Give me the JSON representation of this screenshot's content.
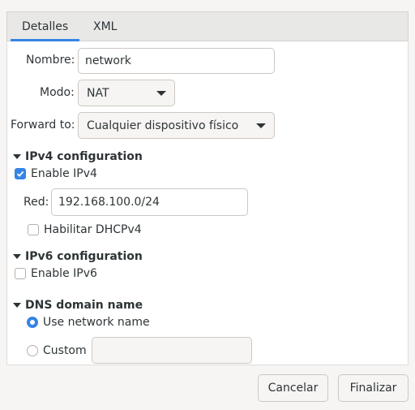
{
  "tabs": [
    {
      "label": "Detalles",
      "active": true
    },
    {
      "label": "XML",
      "active": false
    }
  ],
  "form": {
    "name_label": "Nombre:",
    "name_value": "network",
    "mode_label": "Modo:",
    "mode_value": "NAT",
    "forward_label": "Forward to:",
    "forward_value": "Cualquier dispositivo físico"
  },
  "ipv4": {
    "heading": "IPv4 configuration",
    "enable_label": "Enable IPv4",
    "enable_checked": true,
    "network_label": "Red:",
    "network_value": "192.168.100.0/24",
    "dhcp_label": "Habilitar DHCPv4",
    "dhcp_checked": false
  },
  "ipv6": {
    "heading": "IPv6 configuration",
    "enable_label": "Enable IPv6",
    "enable_checked": false
  },
  "dns": {
    "heading": "DNS domain name",
    "option_network_label": "Use network name",
    "option_custom_label": "Custom",
    "selected": "network",
    "custom_value": ""
  },
  "buttons": {
    "cancel": "Cancelar",
    "finish": "Finalizar"
  },
  "colors": {
    "accent": "#3584e4"
  }
}
